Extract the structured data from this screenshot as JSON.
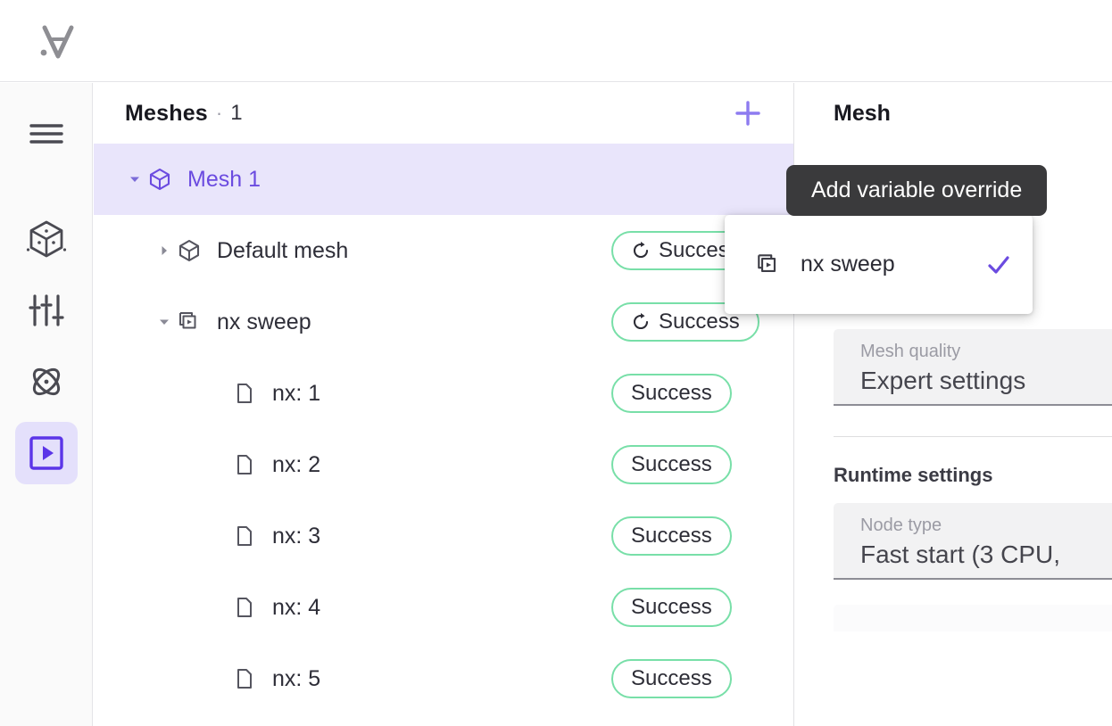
{
  "topbar": {
    "logo_name": "ansys-logo"
  },
  "rail": {
    "items": [
      {
        "name": "menu-toggle",
        "icon": "hamburger-icon",
        "active": false
      },
      {
        "name": "geometry",
        "icon": "cube-icon",
        "active": false
      },
      {
        "name": "settings",
        "icon": "sliders-icon",
        "active": false
      },
      {
        "name": "physics",
        "icon": "atom-icon",
        "active": false
      },
      {
        "name": "simulations",
        "icon": "play-square-icon",
        "active": true
      }
    ]
  },
  "tree": {
    "title": "Meshes",
    "separator": "·",
    "count": "1",
    "add_label": "+",
    "rows": [
      {
        "label": "Mesh 1",
        "icon": "cube-icon",
        "caret": "down",
        "indent": 0,
        "selected": true,
        "badge": null,
        "badge_refresh": false,
        "action": "add-variable-override-icon"
      },
      {
        "label": "Default mesh",
        "icon": "cube-icon",
        "caret": "right",
        "indent": 1,
        "selected": false,
        "badge": "Success",
        "badge_refresh": true,
        "action": null
      },
      {
        "label": "nx sweep",
        "icon": "layers-icon",
        "caret": "down",
        "indent": 1,
        "selected": false,
        "badge": "Success",
        "badge_refresh": true,
        "action": null
      },
      {
        "label": "nx: 1",
        "icon": "file-icon",
        "caret": "none",
        "indent": 2,
        "selected": false,
        "badge": "Success",
        "badge_refresh": false,
        "action": null
      },
      {
        "label": "nx: 2",
        "icon": "file-icon",
        "caret": "none",
        "indent": 2,
        "selected": false,
        "badge": "Success",
        "badge_refresh": false,
        "action": null
      },
      {
        "label": "nx: 3",
        "icon": "file-icon",
        "caret": "none",
        "indent": 2,
        "selected": false,
        "badge": "Success",
        "badge_refresh": false,
        "action": null
      },
      {
        "label": "nx: 4",
        "icon": "file-icon",
        "caret": "none",
        "indent": 2,
        "selected": false,
        "badge": "Success",
        "badge_refresh": false,
        "action": null
      },
      {
        "label": "nx: 5",
        "icon": "file-icon",
        "caret": "none",
        "indent": 2,
        "selected": false,
        "badge": "Success",
        "badge_refresh": false,
        "action": null
      }
    ]
  },
  "tooltip": {
    "text": "Add variable override"
  },
  "menu": {
    "items": [
      {
        "label": "nx sweep",
        "icon": "layers-play-icon",
        "checked": true
      }
    ]
  },
  "detail": {
    "title": "Mesh",
    "mesh_quality_label": "Mesh quality",
    "mesh_quality_value": "Expert settings",
    "runtime_section": "Runtime settings",
    "node_type_label": "Node type",
    "node_type_value": "Fast start (3 CPU,"
  },
  "colors": {
    "accent": "#6b4be0",
    "accent_light": "#8d7bf0",
    "selected_bg": "#e9e5fb",
    "success_border": "#78dfa8",
    "tooltip_bg": "#3a3a3c"
  }
}
